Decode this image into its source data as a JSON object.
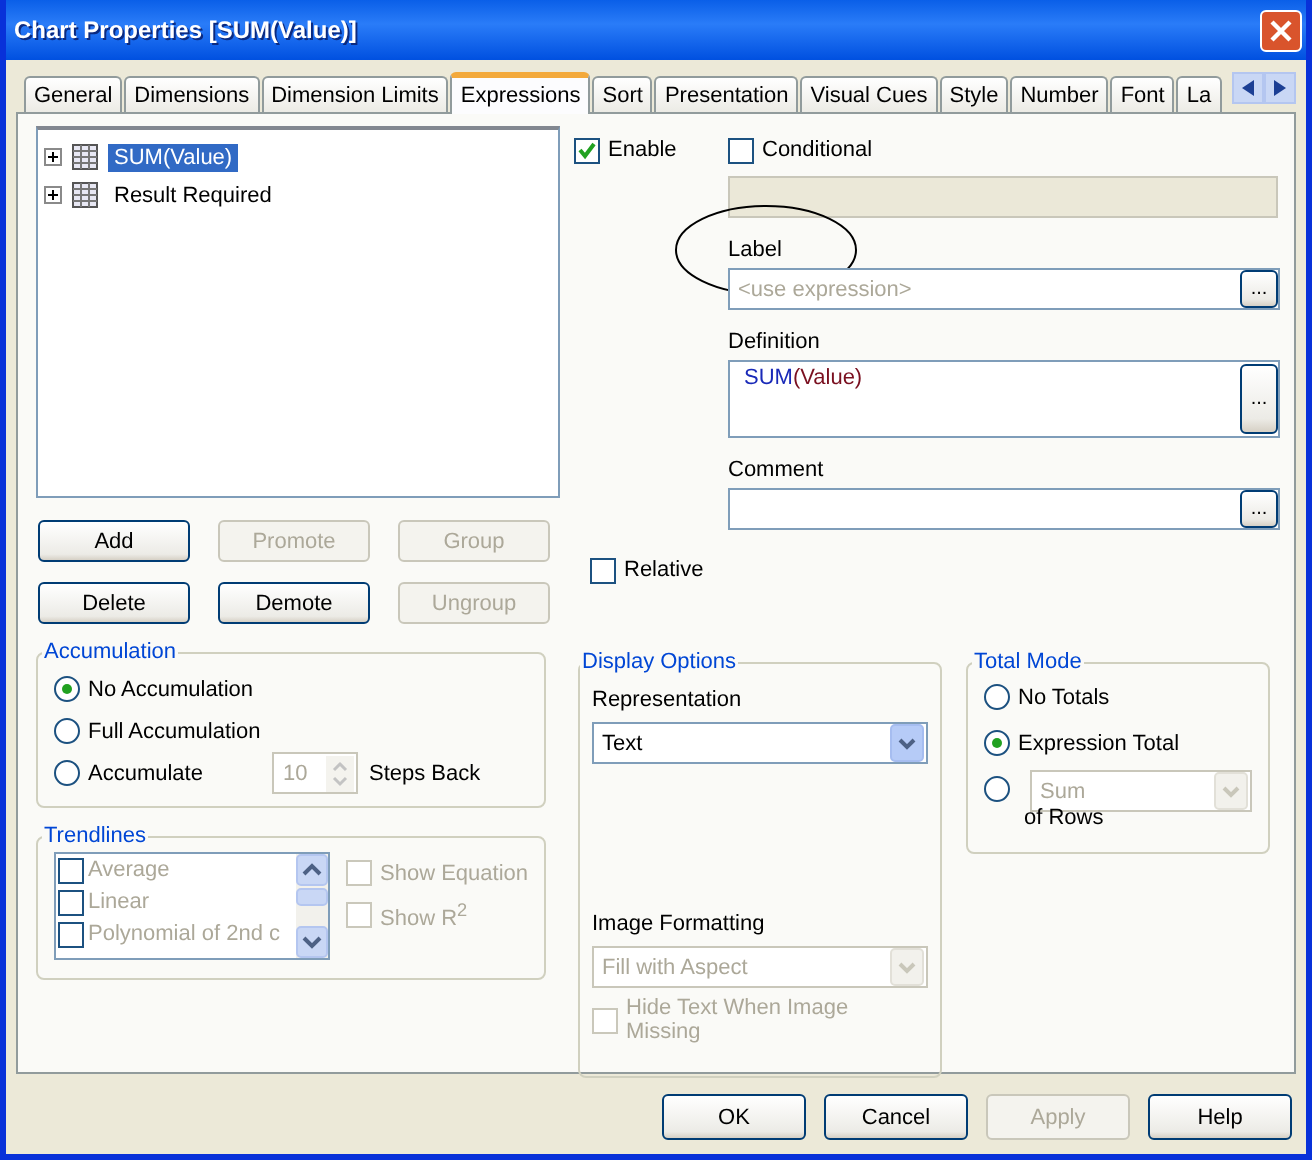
{
  "window": {
    "title": "Chart Properties [SUM(Value)]"
  },
  "tabs": [
    {
      "label": "General",
      "selected": false
    },
    {
      "label": "Dimensions",
      "selected": false
    },
    {
      "label": "Dimension Limits",
      "selected": false
    },
    {
      "label": "Expressions",
      "selected": true
    },
    {
      "label": "Sort",
      "selected": false
    },
    {
      "label": "Presentation",
      "selected": false
    },
    {
      "label": "Visual Cues",
      "selected": false
    },
    {
      "label": "Style",
      "selected": false
    },
    {
      "label": "Number",
      "selected": false
    },
    {
      "label": "Font",
      "selected": false
    },
    {
      "label": "La",
      "selected": false
    }
  ],
  "expressions": [
    {
      "label": "SUM(Value)",
      "selected": true
    },
    {
      "label": "Result Required",
      "selected": false
    }
  ],
  "actions": [
    {
      "label": "Add",
      "disabled": false
    },
    {
      "label": "Promote",
      "disabled": true
    },
    {
      "label": "Group",
      "disabled": true
    },
    {
      "label": "Delete",
      "disabled": false
    },
    {
      "label": "Demote",
      "disabled": false
    },
    {
      "label": "Ungroup",
      "disabled": true
    }
  ],
  "accumulation": {
    "title": "Accumulation",
    "options": [
      {
        "label": "No Accumulation",
        "selected": true
      },
      {
        "label": "Full Accumulation",
        "selected": false
      },
      {
        "label": "Accumulate",
        "selected": false
      }
    ],
    "steps": "10",
    "steps_disabled": true,
    "steps_label": "Steps Back"
  },
  "trendlines": {
    "title": "Trendlines",
    "disabled": true,
    "items": [
      {
        "label": "Average",
        "checked": false
      },
      {
        "label": "Linear",
        "checked": false
      },
      {
        "label": "Polynomial of 2nd c",
        "checked": false
      }
    ],
    "options": [
      {
        "label": "Show Equation",
        "checked": false
      },
      {
        "label": "Show R$^{2}$",
        "checked": false
      }
    ]
  },
  "enable": {
    "label": "Enable",
    "checked": true
  },
  "conditional": {
    "label": "Conditional",
    "checked": false
  },
  "label_field": {
    "label": "Label",
    "placeholder": "<use expression>",
    "button": "..."
  },
  "definition": {
    "label": "Definition",
    "tokens": [
      {
        "text": "SUM",
        "kind": "function"
      },
      {
        "text": "(Value)",
        "kind": "argument"
      }
    ],
    "button": "..."
  },
  "comment": {
    "label": "Comment",
    "button": "..."
  },
  "relative": {
    "label": "Relative",
    "checked": false
  },
  "display_options": {
    "title": "Display Options",
    "representation_label": "Representation",
    "representation": "Text",
    "image_formatting_label": "Image Formatting",
    "image_formatting": "Fill with Aspect",
    "image_formatting_disabled": true,
    "hide_text": {
      "label": "Hide Text When Image Missing",
      "checked": false,
      "disabled": true
    }
  },
  "total_mode": {
    "title": "Total Mode",
    "options": [
      {
        "label": "No Totals",
        "selected": false,
        "kind": "plain"
      },
      {
        "label": "Expression Total",
        "selected": true,
        "kind": "plain"
      },
      {
        "label": "Sum",
        "selected": false,
        "kind": "dropdown"
      }
    ],
    "of_rows": "of Rows"
  },
  "footer": [
    {
      "label": "OK",
      "disabled": false
    },
    {
      "label": "Cancel",
      "disabled": false
    },
    {
      "label": "Apply",
      "disabled": true
    },
    {
      "label": "Help",
      "disabled": false
    }
  ]
}
